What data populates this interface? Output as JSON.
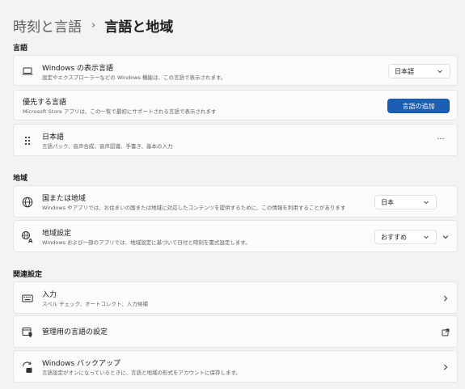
{
  "breadcrumb": {
    "parent": "時刻と言語",
    "separator": "›",
    "current": "言語と地域"
  },
  "sections": {
    "language": "言語",
    "region": "地域",
    "related": "関連設定"
  },
  "display_language": {
    "title": "Windows の表示言語",
    "subtitle": "設定やエクスプローラーなどの Windows 機能は、この言語で表示されます。",
    "selected": "日本語"
  },
  "preferred_languages": {
    "title": "優先する言語",
    "subtitle": "Microsoft Store アプリは、この一覧で最初にサポートされる言語で表示されます",
    "button": "言語の追加"
  },
  "japanese_language": {
    "title": "日本語",
    "subtitle": "言語パック、音声合成、音声認識、手書き、基本の入力",
    "more": "···"
  },
  "country": {
    "title": "国または地域",
    "subtitle": "Windows やアプリでは、お住まいの国または地域に対応したコンテンツを提供するために、この情報を利用することがあります",
    "selected": "日本"
  },
  "regional_format": {
    "title": "地域設定",
    "subtitle": "Windows および一部のアプリでは、地域設定に基づいて日付と時刻を書式設定します。",
    "selected": "おすすめ"
  },
  "typing": {
    "title": "入力",
    "subtitle": "スペル チェック、オートコレクト、入力候補"
  },
  "admin_language": {
    "title": "管理用の言語の設定"
  },
  "windows_backup": {
    "title": "Windows バックアップ",
    "subtitle": "言語設定がオンになっているときに、言語と地域の形式をアカウントに保存します。"
  },
  "colors": {
    "accent": "#1b5fb5",
    "background": "#f3f3f3",
    "card": "#fbfbfb"
  },
  "icons": {
    "display_language": "laptop-icon",
    "japanese_language": "drag-handle-icon",
    "country": "globe-icon",
    "regional_format": "regional-format-icon",
    "typing": "keyboard-icon",
    "admin_language": "admin-shield-icon",
    "windows_backup": "backup-sync-icon"
  }
}
